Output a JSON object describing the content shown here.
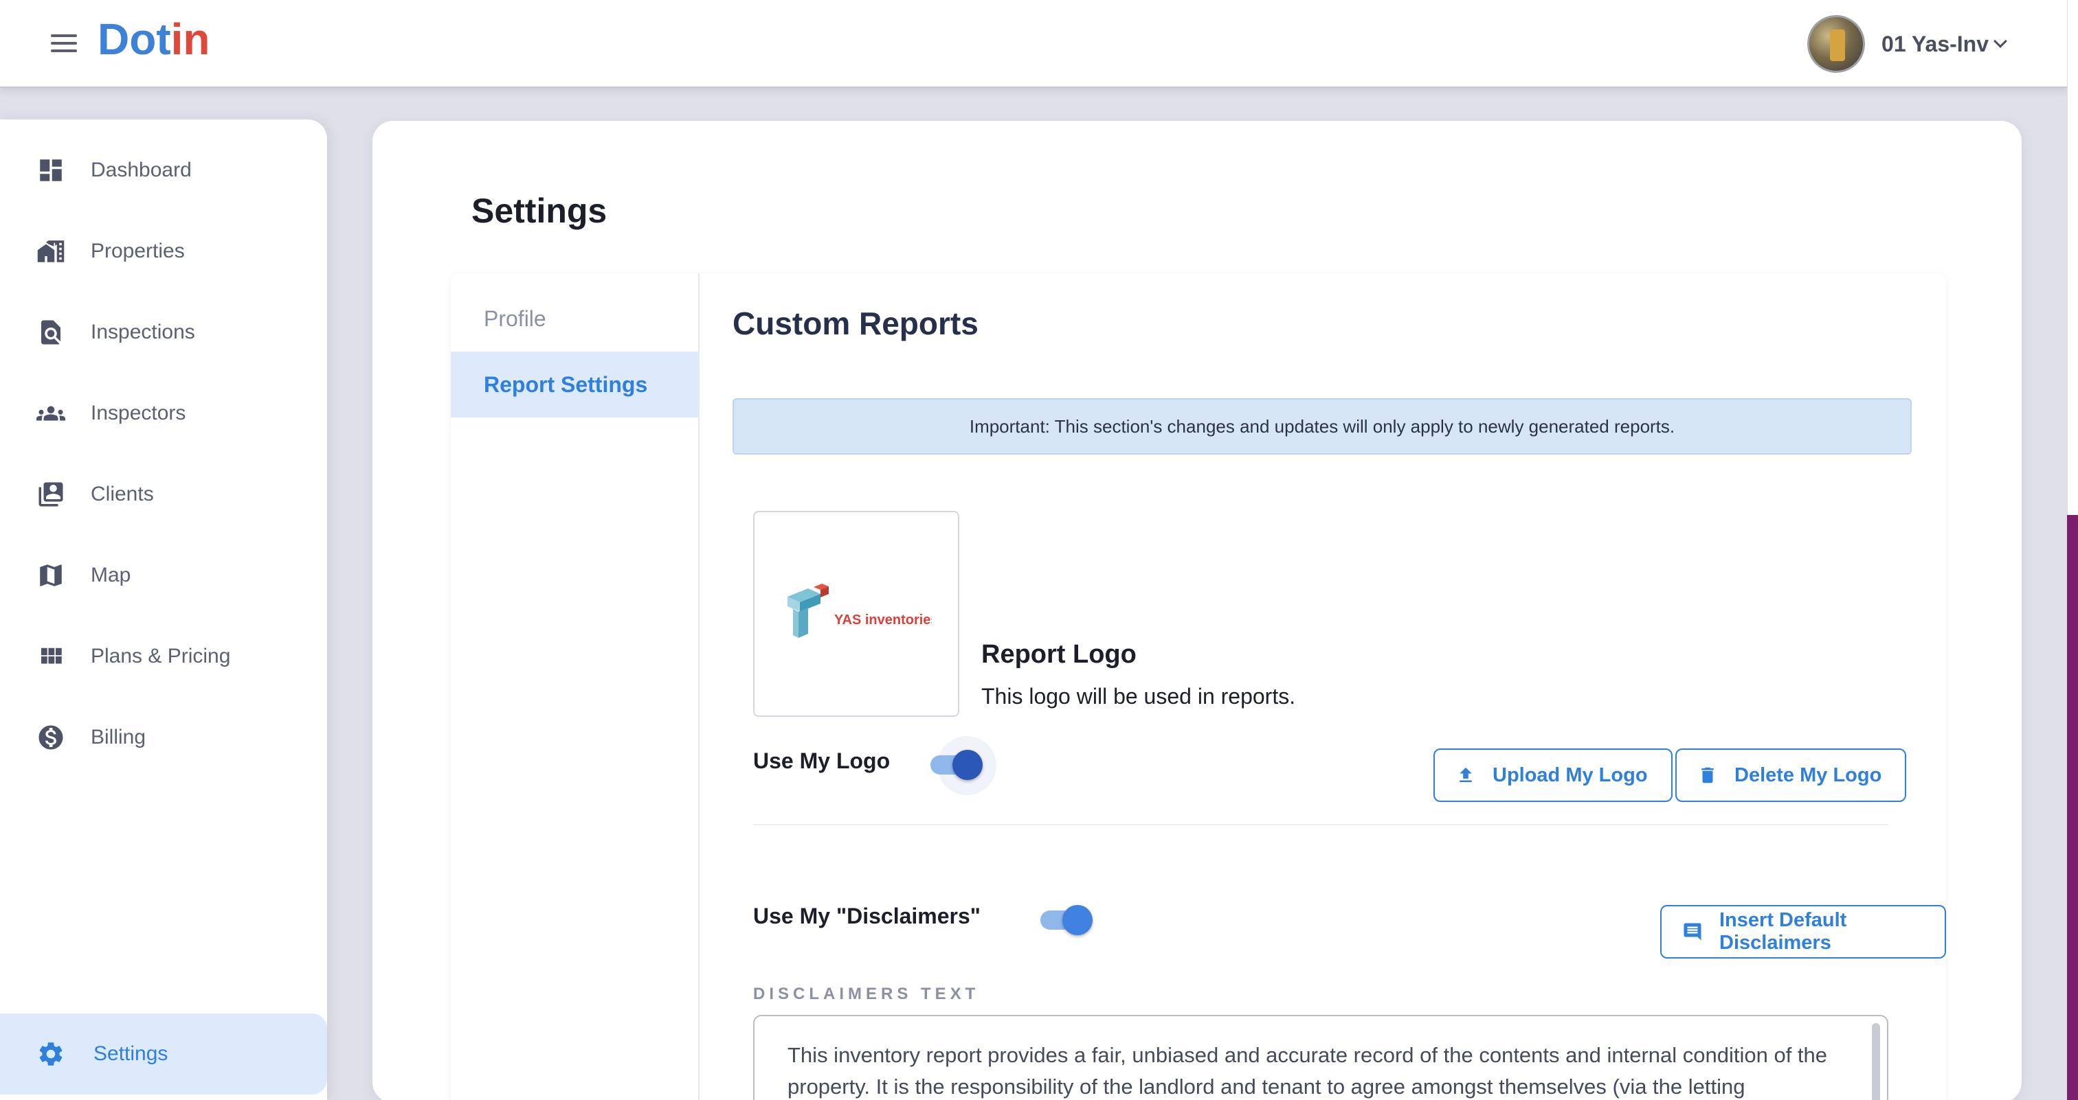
{
  "app": {
    "brand_part1": "Dot",
    "brand_part2": "in",
    "brand_color_1": "#3b82d8",
    "brand_color_2": "#e0483a",
    "accent": "#2f7fdc"
  },
  "header": {
    "user_name": "01 Yas-Inv"
  },
  "sidebar": {
    "items": [
      {
        "label": "Dashboard",
        "icon": "dashboard-icon"
      },
      {
        "label": "Properties",
        "icon": "properties-icon"
      },
      {
        "label": "Inspections",
        "icon": "inspections-icon"
      },
      {
        "label": "Inspectors",
        "icon": "inspectors-icon"
      },
      {
        "label": "Clients",
        "icon": "clients-icon"
      },
      {
        "label": "Map",
        "icon": "map-icon"
      },
      {
        "label": "Plans & Pricing",
        "icon": "plans-icon"
      },
      {
        "label": "Billing",
        "icon": "billing-icon"
      },
      {
        "label": "Settings",
        "icon": "gear-icon",
        "active": true
      }
    ]
  },
  "page": {
    "title": "Settings",
    "tabs": [
      {
        "label": "Profile"
      },
      {
        "label": "Report Settings",
        "active": true
      }
    ]
  },
  "custom_reports": {
    "title": "Custom Reports",
    "notice": "Important: This section's changes and updates will only apply to newly generated reports.",
    "logo_image_text": "YAS inventories",
    "report_logo_title": "Report Logo",
    "report_logo_desc": "This logo will be used in reports.",
    "use_logo_label": "Use My Logo",
    "use_logo_on": true,
    "upload_button": "Upload My Logo",
    "delete_button": "Delete My Logo",
    "use_disclaimers_label": "Use My \"Disclaimers\"",
    "use_disclaimers_on": true,
    "insert_default_button": "Insert Default Disclaimers",
    "disclaimers_caption": "DISCLAIMERS TEXT",
    "disclaimers_text": "This inventory report provides a fair, unbiased and accurate record of the contents and internal condition of the property. It is the responsibility of the landlord and tenant to agree amongst themselves (via the letting"
  }
}
